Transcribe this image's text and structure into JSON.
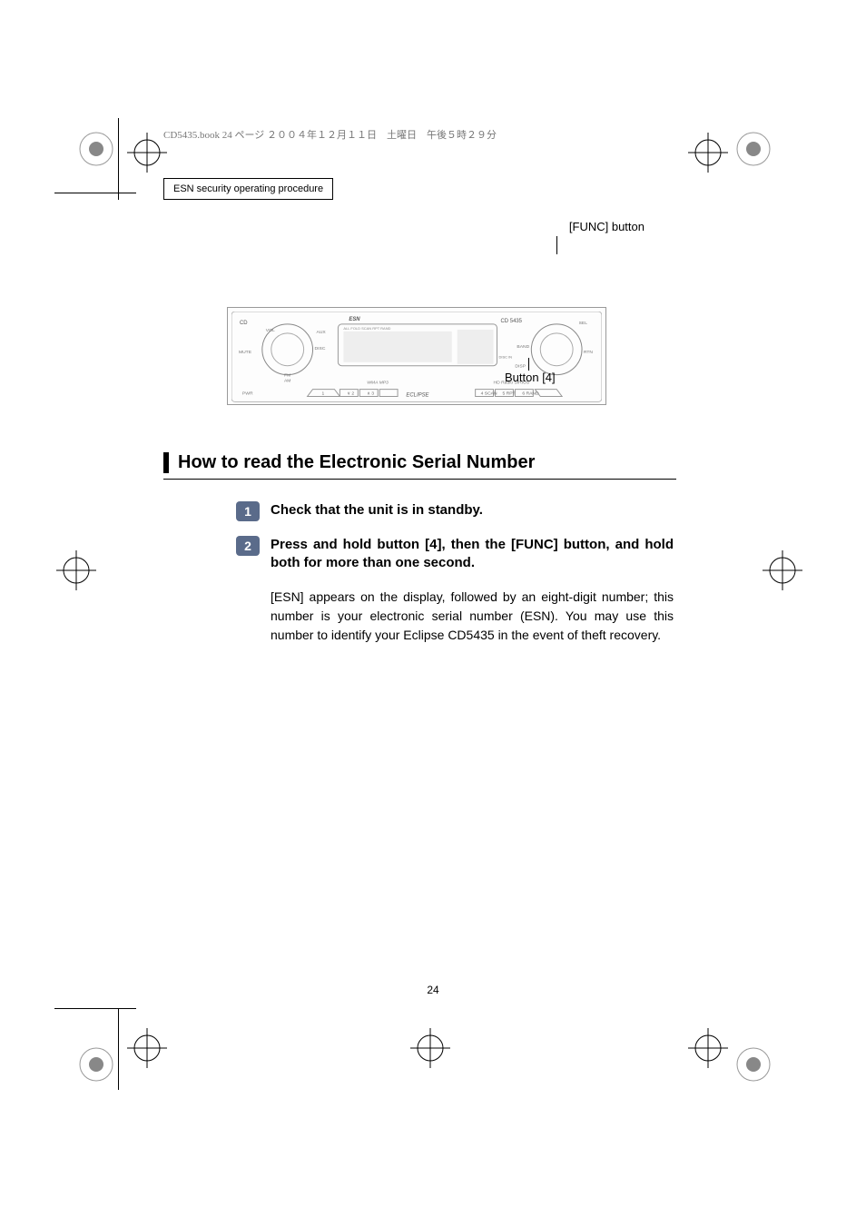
{
  "header_line": "CD5435.book  24 ページ  ２００４年１２月１１日　土曜日　午後５時２９分",
  "chapter": "ESN security operating procedure",
  "callout_func": "[FUNC] button",
  "callout_btn4": "Button [4]",
  "device": {
    "labels": {
      "esn": "ESN",
      "model": "CD 5435",
      "cd": "CD",
      "vol": "VOL",
      "aux": "AUX",
      "disc": "DISC",
      "mute": "MUTE",
      "fmam": "FM\nAM",
      "pwr": "PWR",
      "sel": "SEL",
      "band": "BAND",
      "rtn": "RTN",
      "disp": "DISP",
      "disc_in": "DISC IN",
      "eclipse": "ECLIPSE",
      "sirius": "SIRIUS",
      "hdradio": "HD Radio",
      "wma": "WMA",
      "mp3": "MP3",
      "display_annun": "ALL FOLD SCAN RPT RAND",
      "btns": [
        "1",
        "2",
        "3",
        "4",
        "5",
        "6"
      ],
      "btn_sub": [
        "",
        "SCAN",
        "RPT",
        "RAND"
      ],
      "btn_sub_left": [
        "∨",
        "∧"
      ]
    }
  },
  "section_title": "How to read the Electronic Serial Number",
  "steps": [
    {
      "num": "1",
      "title": "Check that the unit is in standby."
    },
    {
      "num": "2",
      "title": "Press and hold button [4], then the [FUNC] button, and hold both for more than one second.",
      "body": "[ESN] appears on the display, followed by an eight-digit number; this number is your electronic serial number (ESN). You may use this number to identify your Eclipse CD5435 in the event of theft recovery."
    }
  ],
  "page_num": "24"
}
